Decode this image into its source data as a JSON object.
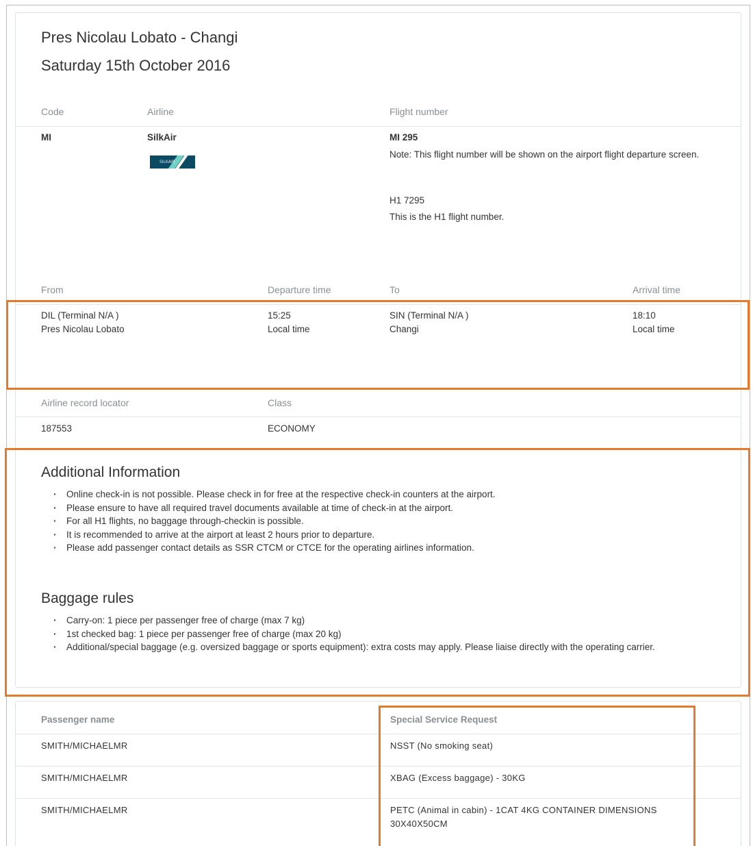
{
  "flight": {
    "route_title": "Pres Nicolau Lobato - Changi",
    "date_title": "Saturday 15th October 2016",
    "labels": {
      "code": "Code",
      "airline": "Airline",
      "flight_number": "Flight number",
      "from": "From",
      "departure_time": "Departure time",
      "to": "To",
      "arrival_time": "Arrival time",
      "record_locator": "Airline record locator",
      "class": "Class"
    },
    "code": "MI",
    "airline": "SilkAir",
    "airline_logo_text": "SILKAIR",
    "flight_number": "MI 295",
    "flight_number_note": "Note: This flight number will be shown on the airport flight departure screen.",
    "h1_number": "H1 7295",
    "h1_note": "This is the H1 flight number.",
    "from_code": "DIL (Terminal N/A )",
    "from_name": "Pres Nicolau Lobato",
    "departure_time": "15:25",
    "departure_tz": "Local time",
    "to_code": "SIN (Terminal N/A )",
    "to_name": "Changi",
    "arrival_time": "18:10",
    "arrival_tz": "Local time",
    "record_locator": "187553",
    "class": "ECONOMY"
  },
  "additional_info": {
    "title": "Additional Information",
    "items": [
      "Online check-in is not possible. Please check in for free at the respective check-in counters at the airport.",
      "Please ensure to have all required travel documents available at time of check-in at the airport.",
      "For all H1 flights, no baggage through-checkin is possible.",
      "It is recommended to arrive at the airport at least 2 hours prior to departure.",
      "Please add passenger contact details as SSR CTCM or CTCE for the operating airlines information."
    ]
  },
  "baggage_rules": {
    "title": "Baggage rules",
    "items": [
      "Carry-on: 1 piece per passenger free of charge (max 7 kg)",
      "1st checked bag: 1 piece per passenger free of charge (max 20 kg)",
      "Additional/special baggage (e.g. oversized baggage or sports equipment): extra costs may apply. Please liaise directly with the operating carrier."
    ]
  },
  "passengers": {
    "header_name": "Passenger name",
    "header_ssr": "Special Service Request",
    "rows": [
      {
        "name": "SMITH/MICHAELMR",
        "ssr": "NSST (No smoking seat)"
      },
      {
        "name": "SMITH/MICHAELMR",
        "ssr": "XBAG (Excess baggage) - 30KG"
      },
      {
        "name": "SMITH/MICHAELMR",
        "ssr": "PETC (Animal in cabin) - 1CAT 4KG CONTAINER DIMENSIONS 30X40X50CM"
      }
    ]
  },
  "highlight_color": "#e47a2b"
}
